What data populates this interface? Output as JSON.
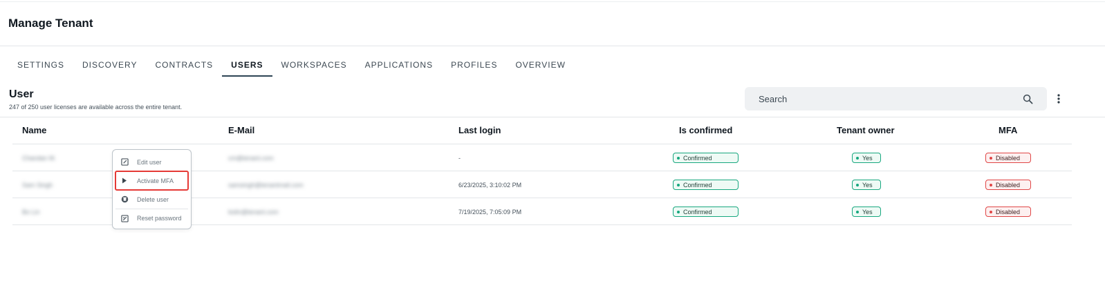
{
  "page": {
    "title": "Manage Tenant"
  },
  "tabs": [
    {
      "label": "SETTINGS",
      "active": false
    },
    {
      "label": "DISCOVERY",
      "active": false
    },
    {
      "label": "CONTRACTS",
      "active": false
    },
    {
      "label": "USERS",
      "active": true
    },
    {
      "label": "WORKSPACES",
      "active": false
    },
    {
      "label": "APPLICATIONS",
      "active": false
    },
    {
      "label": "PROFILES",
      "active": false
    },
    {
      "label": "OVERVIEW",
      "active": false
    }
  ],
  "section": {
    "title": "User",
    "subtitle": "247 of 250 user licenses are available across the entire tenant."
  },
  "search": {
    "placeholder": "Search"
  },
  "table": {
    "headers": {
      "name": "Name",
      "email": "E-Mail",
      "last_login": "Last login",
      "is_confirmed": "Is confirmed",
      "tenant_owner": "Tenant owner",
      "mfa": "MFA"
    },
    "rows": [
      {
        "name": "Chandan M.",
        "email": "cm@tenant.com",
        "last_login": "-",
        "is_confirmed": "Confirmed",
        "tenant_owner": "Yes",
        "mfa": "Disabled"
      },
      {
        "name": "Sam Singh",
        "email": "samsingh@tenantmail.com",
        "last_login": "6/23/2025, 3:10:02 PM",
        "is_confirmed": "Confirmed",
        "tenant_owner": "Yes",
        "mfa": "Disabled"
      },
      {
        "name": "Bo Lin",
        "email": "bolin@tenant.com",
        "last_login": "7/19/2025, 7:05:09 PM",
        "is_confirmed": "Confirmed",
        "tenant_owner": "Yes",
        "mfa": "Disabled"
      }
    ]
  },
  "context_menu": {
    "items": [
      {
        "label": "Edit user",
        "icon": "edit-icon"
      },
      {
        "label": "Activate MFA",
        "icon": "play-icon",
        "highlighted": true
      },
      {
        "label": "Delete user",
        "icon": "delete-icon"
      },
      {
        "label": "Reset password",
        "icon": "reset-password-icon"
      }
    ]
  },
  "colors": {
    "accent": "#2d4454",
    "confirmed": "#16a77e",
    "disabled": "#e04545",
    "highlight": "#e53935"
  }
}
